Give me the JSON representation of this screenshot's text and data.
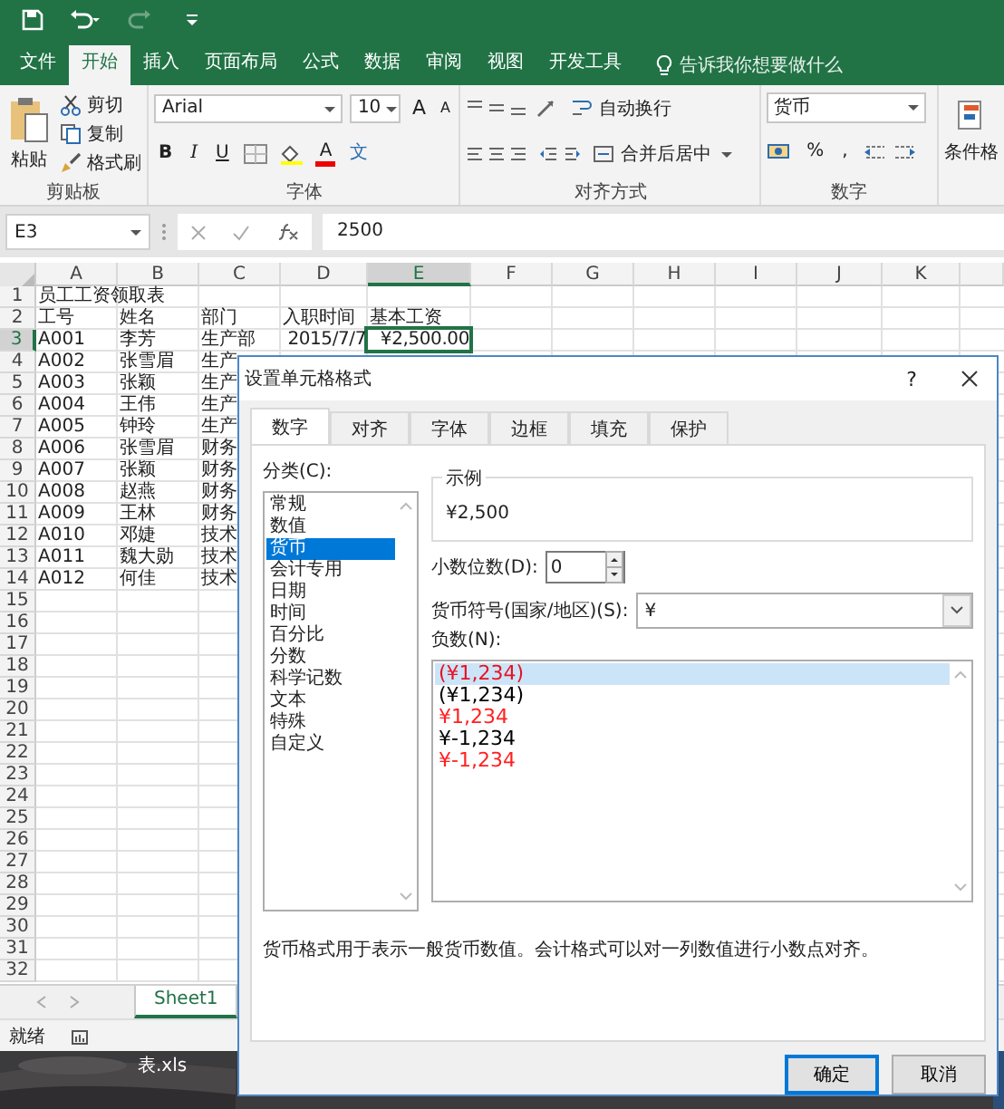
{
  "ribbon_tabs": [
    {
      "label": "文件",
      "selected": false
    },
    {
      "label": "开始",
      "selected": true
    },
    {
      "label": "插入",
      "selected": false
    },
    {
      "label": "页面布局",
      "selected": false
    },
    {
      "label": "公式",
      "selected": false
    },
    {
      "label": "数据",
      "selected": false
    },
    {
      "label": "审阅",
      "selected": false
    },
    {
      "label": "视图",
      "selected": false
    },
    {
      "label": "开发工具",
      "selected": false
    }
  ],
  "tell_me": "告诉我你想要做什么",
  "ribbon": {
    "clipboard": {
      "paste": "粘贴",
      "cut": "剪切",
      "copy": "复制",
      "format_painter": "格式刷",
      "label": "剪贴板"
    },
    "font": {
      "name": "Arial",
      "size": "10",
      "grow": "A",
      "shrink": "A",
      "bold": "B",
      "italic": "I",
      "underline": "U",
      "font_color": "A",
      "phonetic": "文",
      "label": "字体"
    },
    "alignment": {
      "wrap": "自动换行",
      "merge": "合并后居中",
      "label": "对齐方式"
    },
    "number": {
      "format": "货币",
      "percent": "%",
      "comma": ",",
      "label": "数字"
    },
    "styles": {
      "conditional": "条件格"
    }
  },
  "formula_bar": {
    "name_box": "E3",
    "value": "2500"
  },
  "sheet": {
    "columns": [
      {
        "label": "A",
        "selected": false
      },
      {
        "label": "B",
        "selected": false
      },
      {
        "label": "C",
        "selected": false
      },
      {
        "label": "D",
        "selected": false
      },
      {
        "label": "E",
        "selected": true
      },
      {
        "label": "F",
        "selected": false
      },
      {
        "label": "G",
        "selected": false
      },
      {
        "label": "H",
        "selected": false
      },
      {
        "label": "I",
        "selected": false
      },
      {
        "label": "J",
        "selected": false
      },
      {
        "label": "K",
        "selected": false
      }
    ],
    "rows": [
      {
        "number": "1",
        "selected": false,
        "cells": [
          "员工工资领取表"
        ]
      },
      {
        "number": "2",
        "selected": false,
        "cells": [
          "工号",
          "姓名",
          "部门",
          "入职时间",
          "基本工资"
        ]
      },
      {
        "number": "3",
        "selected": true,
        "cells": [
          "A001",
          "李芳",
          "生产部",
          {
            "text": "2015/7/7",
            "kind": "number"
          },
          {
            "text": "¥2,500.00",
            "kind": "number"
          }
        ]
      },
      {
        "number": "4",
        "selected": false,
        "cells": [
          "A002",
          "张雪眉",
          "生产"
        ]
      },
      {
        "number": "5",
        "selected": false,
        "cells": [
          "A003",
          "张颖",
          "生产"
        ]
      },
      {
        "number": "6",
        "selected": false,
        "cells": [
          "A004",
          "王伟",
          "生产"
        ]
      },
      {
        "number": "7",
        "selected": false,
        "cells": [
          "A005",
          "钟玲",
          "生产"
        ]
      },
      {
        "number": "8",
        "selected": false,
        "cells": [
          "A006",
          "张雪眉",
          "财务"
        ]
      },
      {
        "number": "9",
        "selected": false,
        "cells": [
          "A007",
          "张颖",
          "财务"
        ]
      },
      {
        "number": "10",
        "selected": false,
        "cells": [
          "A008",
          "赵燕",
          "财务"
        ]
      },
      {
        "number": "11",
        "selected": false,
        "cells": [
          "A009",
          "王林",
          "财务"
        ]
      },
      {
        "number": "12",
        "selected": false,
        "cells": [
          "A010",
          "邓婕",
          "技术"
        ]
      },
      {
        "number": "13",
        "selected": false,
        "cells": [
          "A011",
          "魏大勋",
          "技术"
        ]
      },
      {
        "number": "14",
        "selected": false,
        "cells": [
          "A012",
          "何佳",
          "技术"
        ]
      },
      {
        "number": "15",
        "selected": false
      },
      {
        "number": "16",
        "selected": false
      },
      {
        "number": "17",
        "selected": false
      },
      {
        "number": "18",
        "selected": false
      },
      {
        "number": "19",
        "selected": false
      },
      {
        "number": "20",
        "selected": false
      },
      {
        "number": "21",
        "selected": false
      },
      {
        "number": "22",
        "selected": false
      },
      {
        "number": "23",
        "selected": false
      },
      {
        "number": "24",
        "selected": false
      },
      {
        "number": "25",
        "selected": false
      },
      {
        "number": "26",
        "selected": false
      },
      {
        "number": "27",
        "selected": false
      },
      {
        "number": "28",
        "selected": false
      },
      {
        "number": "29",
        "selected": false
      },
      {
        "number": "30",
        "selected": false
      },
      {
        "number": "31",
        "selected": false
      },
      {
        "number": "32",
        "selected": false
      }
    ]
  },
  "sheet_tabs": [
    {
      "label": "Sheet1",
      "selected": true
    }
  ],
  "status_bar": {
    "text": "就绪"
  },
  "desktop": {
    "file_label": "表.xls"
  },
  "dialog": {
    "title": "设置单元格格式",
    "help": "?",
    "tabs": [
      {
        "label": "数字",
        "selected": true
      },
      {
        "label": "对齐",
        "selected": false
      },
      {
        "label": "字体",
        "selected": false
      },
      {
        "label": "边框",
        "selected": false
      },
      {
        "label": "填充",
        "selected": false
      },
      {
        "label": "保护",
        "selected": false
      }
    ],
    "category_label": "分类(C):",
    "categories": [
      {
        "label": "常规",
        "selected": false
      },
      {
        "label": "数值",
        "selected": false
      },
      {
        "label": "货币",
        "selected": true
      },
      {
        "label": "会计专用",
        "selected": false
      },
      {
        "label": "日期",
        "selected": false
      },
      {
        "label": "时间",
        "selected": false
      },
      {
        "label": "百分比",
        "selected": false
      },
      {
        "label": "分数",
        "selected": false
      },
      {
        "label": "科学记数",
        "selected": false
      },
      {
        "label": "文本",
        "selected": false
      },
      {
        "label": "特殊",
        "selected": false
      },
      {
        "label": "自定义",
        "selected": false
      }
    ],
    "sample_label": "示例",
    "sample": "¥2,500",
    "decimals_label": "小数位数(D):",
    "decimals": "0",
    "symbol_label": "货币符号(国家/地区)(S):",
    "symbol": "¥",
    "negative_label": "负数(N):",
    "negatives": [
      {
        "label": "(¥1,234)",
        "color": "#e81123",
        "selected": true
      },
      {
        "label": "(¥1,234)",
        "color": "#000000",
        "selected": false
      },
      {
        "label": "¥1,234",
        "color": "#ff2020",
        "selected": false
      },
      {
        "label": "¥-1,234",
        "color": "#000000",
        "selected": false
      },
      {
        "label": "¥-1,234",
        "color": "#ff2020",
        "selected": false
      }
    ],
    "description": "货币格式用于表示一般货币数值。会计格式可以对一列数值进行小数点对齐。",
    "buttons": [
      {
        "label": "确定",
        "default": true
      },
      {
        "label": "取消",
        "default": false
      }
    ]
  }
}
